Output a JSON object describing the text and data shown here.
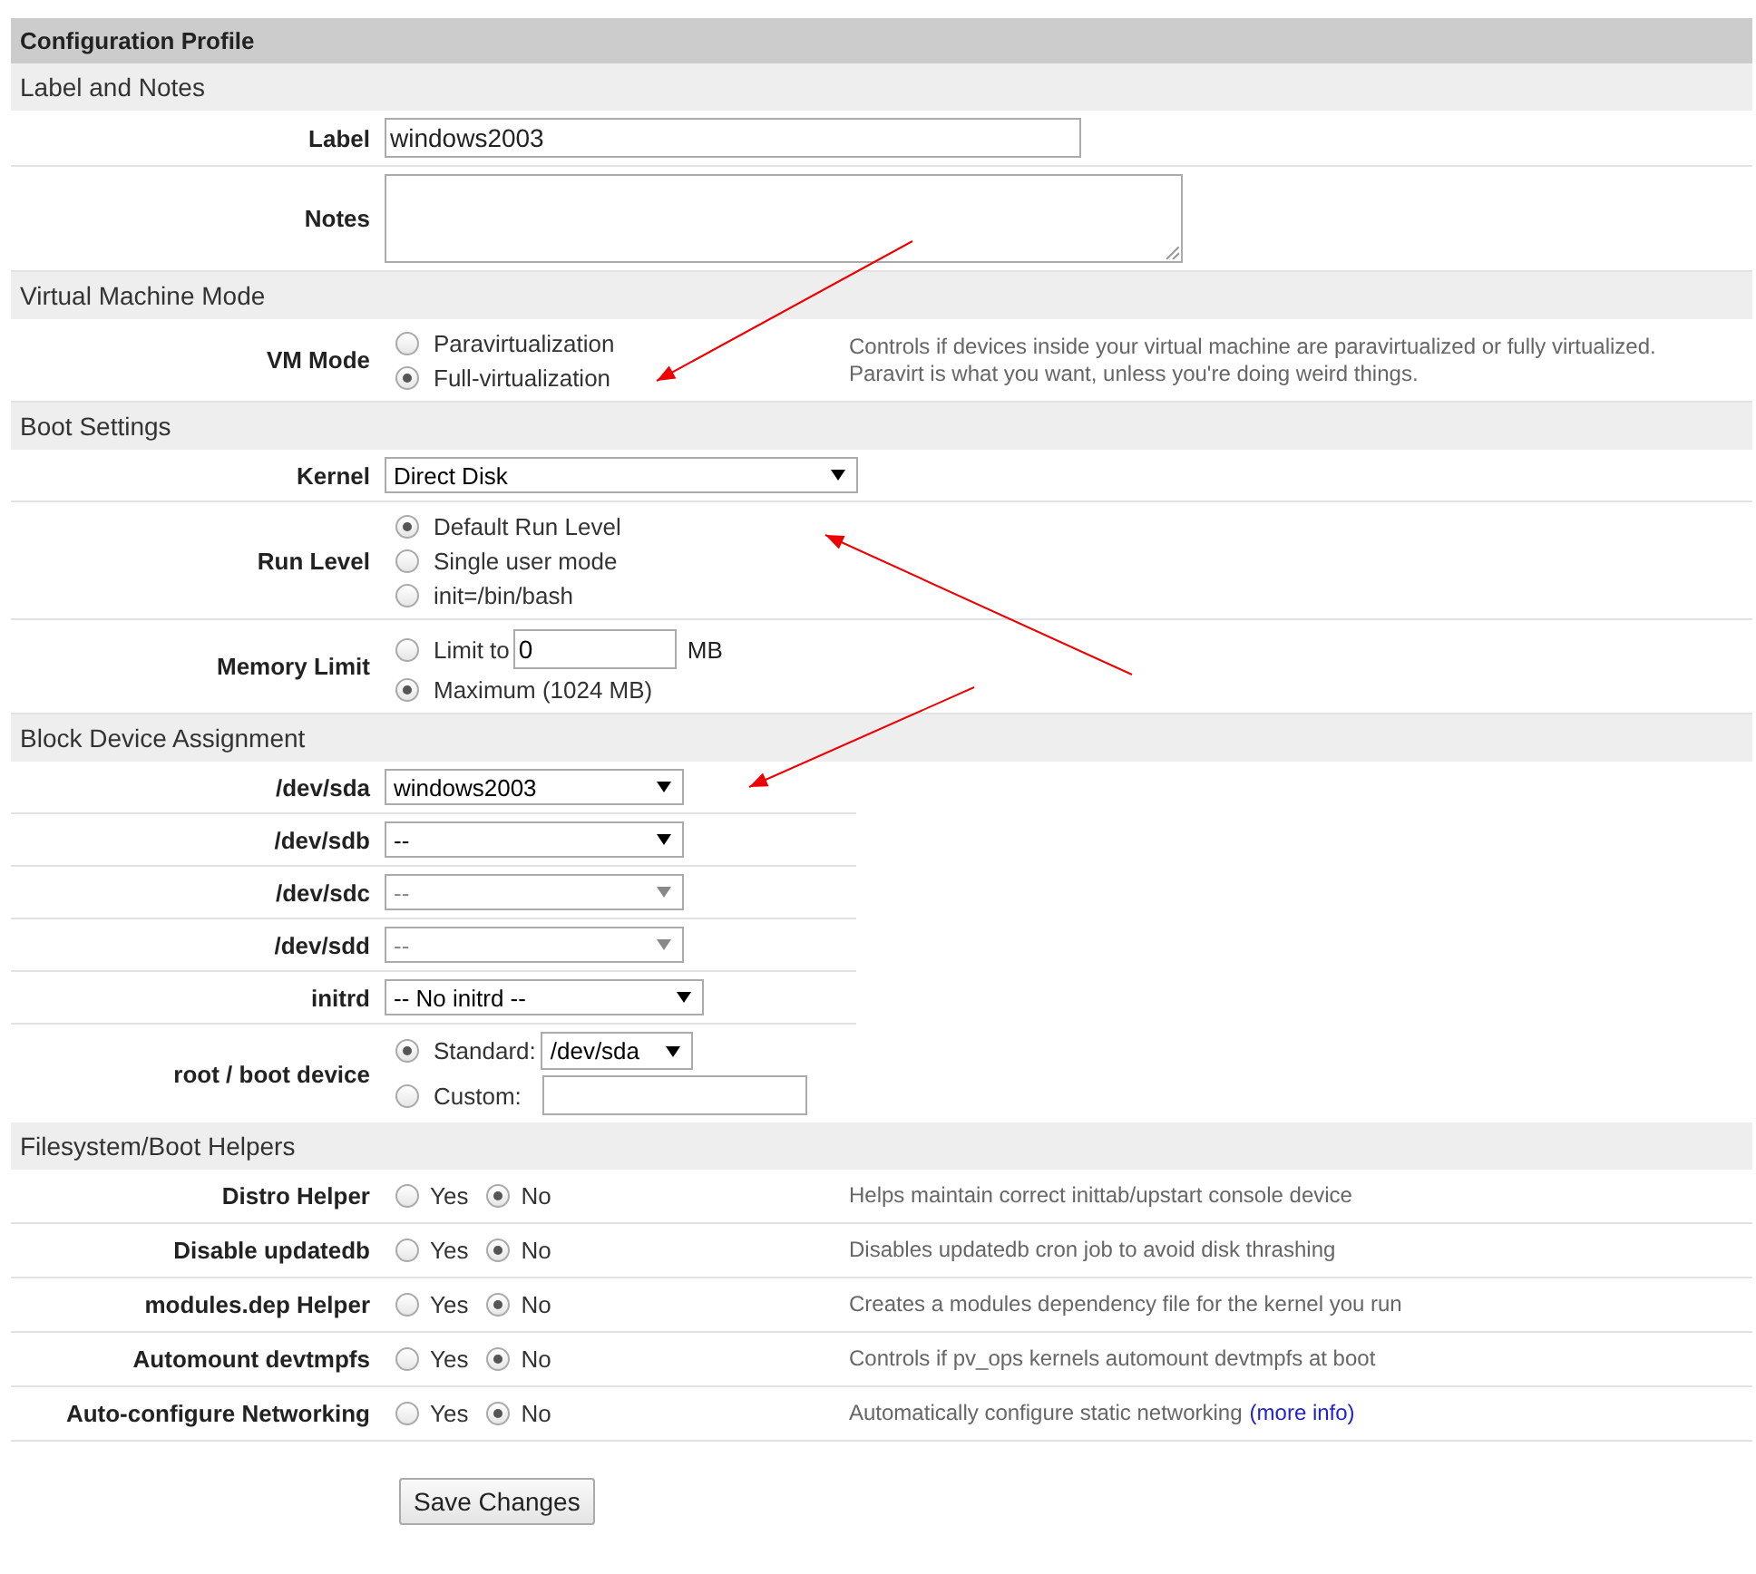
{
  "title": "Configuration Profile",
  "sections": [
    {
      "heading": "Label and Notes",
      "rows": [
        {
          "kind": "text",
          "label": "Label",
          "value": "windows2003"
        },
        {
          "kind": "textarea",
          "label": "Notes"
        }
      ]
    },
    {
      "heading": "Virtual Machine Mode",
      "rows": [
        {
          "kind": "radios",
          "label": "VM Mode",
          "options": [
            {
              "label": "Paravirtualization",
              "selected": false
            },
            {
              "label": "Full-virtualization",
              "selected": true
            }
          ],
          "description": "Controls if devices inside your virtual machine are paravirtualized or fully virtualized. Paravirt is what you want, unless you're doing weird things."
        }
      ]
    },
    {
      "heading": "Boot Settings",
      "rows": [
        {
          "kind": "select",
          "label": "Kernel",
          "value": "Direct Disk",
          "disabled": false
        },
        {
          "kind": "radios",
          "label": "Run Level",
          "options": [
            {
              "label": "Default Run Level",
              "selected": true
            },
            {
              "label": "Single user mode",
              "selected": false
            },
            {
              "label": "init=/bin/bash",
              "selected": false
            }
          ]
        },
        {
          "kind": "radios",
          "label": "Memory Limit",
          "options": [
            {
              "label": "Limit to",
              "selected": false,
              "kind": "field",
              "value": "0",
              "unit": "MB"
            },
            {
              "label": "Maximum (1024 MB)",
              "selected": true
            }
          ]
        }
      ]
    },
    {
      "heading": "Block Device Assignment",
      "rows": [
        {
          "kind": "select",
          "label": "/dev/sda",
          "value": "windows2003",
          "disabled": false
        },
        {
          "kind": "select",
          "label": "/dev/sdb",
          "value": "--",
          "disabled": false
        },
        {
          "kind": "select",
          "label": "/dev/sdc",
          "value": "--",
          "disabled": true
        },
        {
          "kind": "select",
          "label": "/dev/sdd",
          "value": "--",
          "disabled": true
        },
        {
          "kind": "select",
          "label": "initrd",
          "value": "-- No initrd --",
          "disabled": false
        },
        {
          "kind": "radios",
          "label": "root / boot device",
          "options": [
            {
              "label": "Standard:",
              "selected": true,
              "kind": "select",
              "value": "/dev/sda"
            },
            {
              "label": "Custom:",
              "selected": false,
              "kind": "field"
            }
          ]
        }
      ]
    },
    {
      "heading": "Filesystem/Boot Helpers",
      "rows": [
        {
          "kind": "yesno",
          "label": "Distro Helper",
          "options": [
            {
              "label": "Yes",
              "selected": false
            },
            {
              "label": "No",
              "selected": true
            }
          ],
          "description": "Helps maintain correct inittab/upstart console device"
        },
        {
          "kind": "yesno",
          "label": "Disable updatedb",
          "options": [
            {
              "label": "Yes",
              "selected": false
            },
            {
              "label": "No",
              "selected": true
            }
          ],
          "description": "Disables updatedb cron job to avoid disk thrashing"
        },
        {
          "kind": "yesno",
          "label": "modules.dep Helper",
          "options": [
            {
              "label": "Yes",
              "selected": false
            },
            {
              "label": "No",
              "selected": true
            }
          ],
          "description": "Creates a modules dependency file for the kernel you run"
        },
        {
          "kind": "yesno",
          "label": "Automount devtmpfs",
          "options": [
            {
              "label": "Yes",
              "selected": false
            },
            {
              "label": "No",
              "selected": true
            }
          ],
          "description": "Controls if pv_ops kernels automount devtmpfs at boot"
        },
        {
          "kind": "yesno",
          "label": "Auto-configure Networking",
          "options": [
            {
              "label": "Yes",
              "selected": false
            },
            {
              "label": "No",
              "selected": true
            }
          ],
          "description": "Automatically configure static networking",
          "link": "(more info)"
        }
      ]
    }
  ],
  "save_button": "Save Changes"
}
